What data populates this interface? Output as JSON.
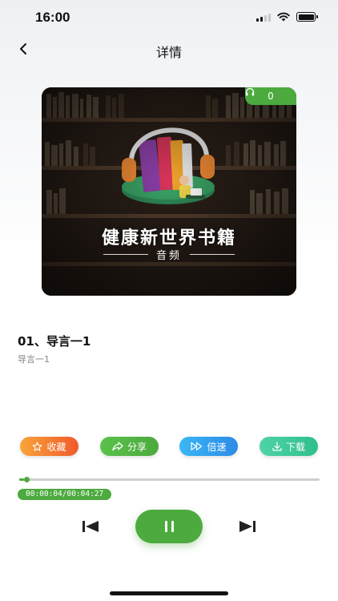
{
  "status_bar": {
    "time": "16:00"
  },
  "nav": {
    "title": "详情",
    "back_icon": "chevron-left-icon"
  },
  "cover": {
    "listen_count": "0",
    "title": "健康新世界书籍",
    "subtitle": "音频"
  },
  "track": {
    "title": "01、导言一1",
    "description": "导言一1"
  },
  "actions": [
    {
      "label": "收藏",
      "icon": "star-icon",
      "color_from": "#f9a43a",
      "color_to": "#f05a2c"
    },
    {
      "label": "分享",
      "icon": "share-icon",
      "color_from": "#5ac24a",
      "color_to": "#4caa3e"
    },
    {
      "label": "倍速",
      "icon": "speed-icon",
      "color_from": "#3ab7f5",
      "color_to": "#2e8ae6"
    },
    {
      "label": "下载",
      "icon": "download-icon",
      "color_from": "#4fd3a6",
      "color_to": "#2fbf8c"
    }
  ],
  "player": {
    "time_display": "00:00:04/00:04:27",
    "progress_fraction": 0.015,
    "accent": "#4caa3e"
  }
}
